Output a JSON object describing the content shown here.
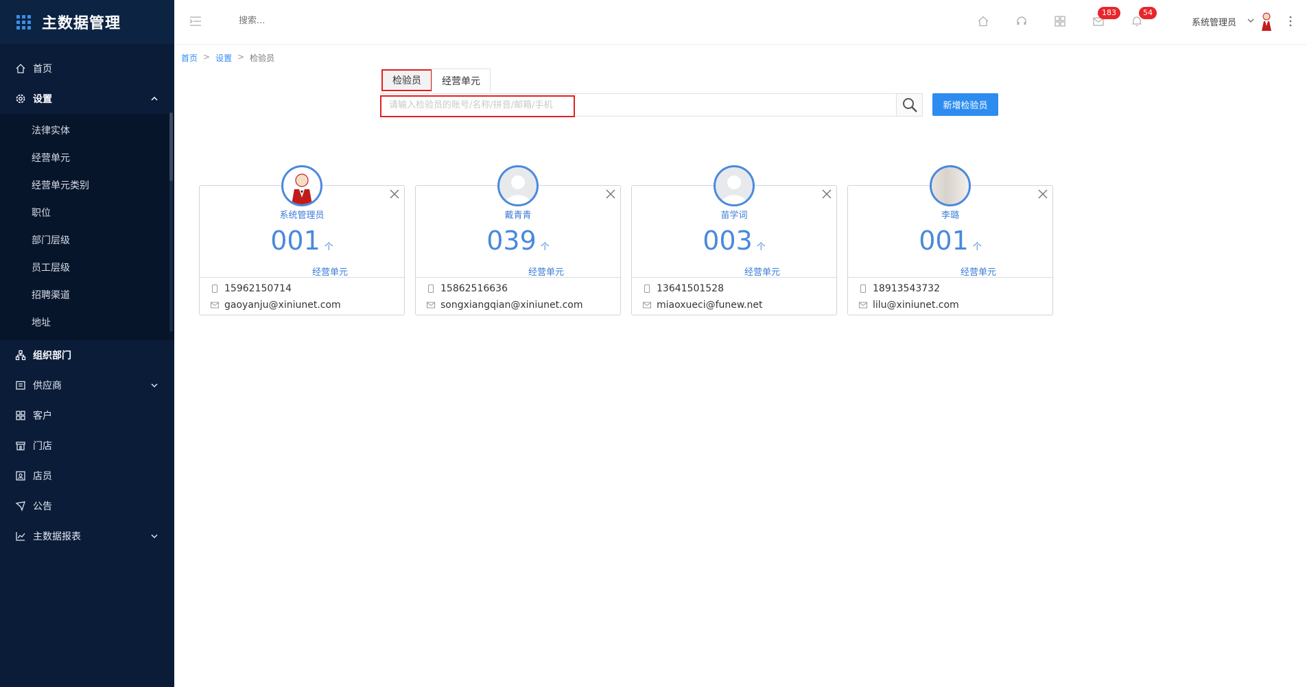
{
  "app": {
    "title": "主数据管理"
  },
  "sidebar": {
    "items": [
      {
        "label": "首页",
        "icon": "home-icon"
      },
      {
        "label": "设置",
        "icon": "gear-icon"
      },
      {
        "label": "组织部门",
        "icon": "org-icon"
      },
      {
        "label": "供应商",
        "icon": "supplier-icon"
      },
      {
        "label": "客户",
        "icon": "customer-icon"
      },
      {
        "label": "门店",
        "icon": "store-icon"
      },
      {
        "label": "店员",
        "icon": "clerk-icon"
      },
      {
        "label": "公告",
        "icon": "announcement-icon"
      },
      {
        "label": "主数据报表",
        "icon": "chart-icon"
      }
    ],
    "settings_sub": [
      "法律实体",
      "经营单元",
      "经营单元类别",
      "职位",
      "部门层级",
      "员工层级",
      "招聘渠道",
      "地址"
    ]
  },
  "topbar": {
    "search_placeholder": "搜索...",
    "badge_mail": "183",
    "badge_bell": "54",
    "user": "系统管理员"
  },
  "breadcrumb": {
    "home": "首页",
    "settings": "设置",
    "current": "检验员"
  },
  "tabs": [
    "检验员",
    "经营单元"
  ],
  "search": {
    "placeholder": "请输入检验员的账号/名称/拼音/邮箱/手机"
  },
  "add_button": "新增检验员",
  "cards": [
    {
      "name": "系统管理员",
      "count": "001",
      "unit": "个",
      "label": "经营单元",
      "phone": "15962150714",
      "email": "gaoyanju@xiniunet.com"
    },
    {
      "name": "戴青青",
      "count": "039",
      "unit": "个",
      "label": "经营单元",
      "phone": "15862516636",
      "email": "songxiangqian@xiniunet.com"
    },
    {
      "name": "苗学词",
      "count": "003",
      "unit": "个",
      "label": "经营单元",
      "phone": "13641501528",
      "email": "miaoxueci@funew.net"
    },
    {
      "name": "李璐",
      "count": "001",
      "unit": "个",
      "label": "经营单元",
      "phone": "18913543732",
      "email": "lilu@xiniunet.com"
    }
  ]
}
